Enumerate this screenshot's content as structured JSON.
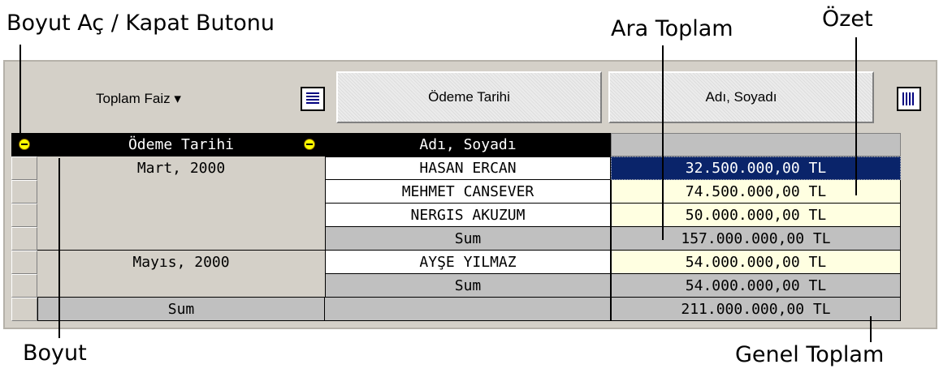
{
  "annotations": {
    "toggle_button": "Boyut Aç / Kapat Butonu",
    "subtotal": "Ara Toplam",
    "summary": "Özet",
    "dimension": "Boyut",
    "grand_total": "Genel Toplam"
  },
  "toolbar": {
    "data_field": "Toplam Faiz",
    "data_field_arrow": "▾",
    "row_field_button": "Ödeme Tarihi",
    "column_field_button": "Adı, Soyadı"
  },
  "grid": {
    "headers": {
      "dimension": "Ödeme Tarihi",
      "name": "Adı, Soyadı",
      "value": ""
    },
    "groups": [
      {
        "period": "Mart, 2000",
        "rows": [
          {
            "name": "HASAN ERCAN",
            "value": "32.500.000,00 TL",
            "selected": true
          },
          {
            "name": "MEHMET CANSEVER",
            "value": "74.500.000,00 TL"
          },
          {
            "name": "NERGIS AKUZUM",
            "value": "50.000.000,00 TL"
          }
        ],
        "subtotal_label": "Sum",
        "subtotal_value": "157.000.000,00 TL"
      },
      {
        "period": "Mayıs, 2000",
        "rows": [
          {
            "name": "AYŞE YILMAZ",
            "value": "54.000.000,00 TL"
          }
        ],
        "subtotal_label": "Sum",
        "subtotal_value": "54.000.000,00 TL"
      }
    ],
    "grand_total_label": "Sum",
    "grand_total_value": "211.000.000,00 TL"
  },
  "colors": {
    "header_bg": "#000000",
    "selected_bg": "#0a246a",
    "value_bg": "#ffffe1",
    "sum_bg": "#c0c0c0",
    "panel_bg": "#d4d0c8"
  }
}
